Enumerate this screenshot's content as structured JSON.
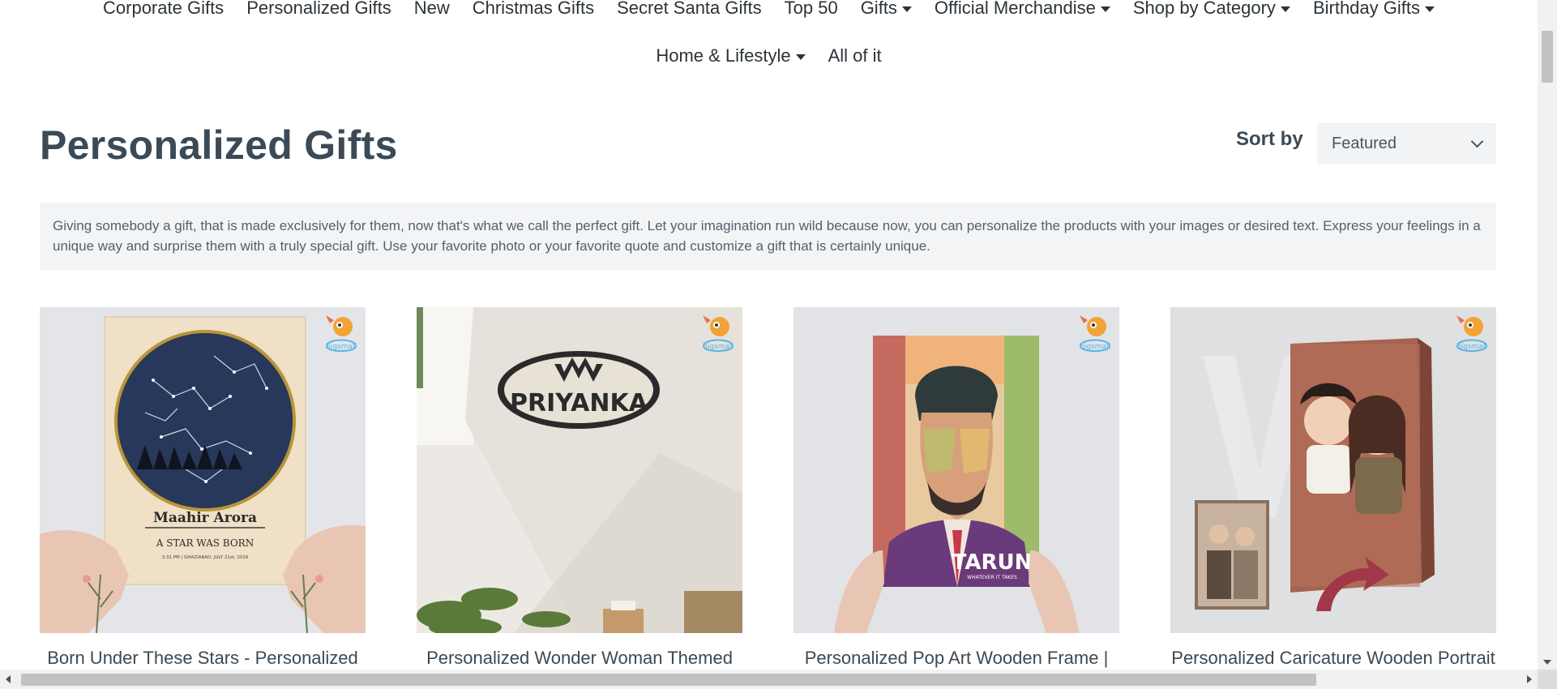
{
  "nav": {
    "row1": [
      {
        "label": "Corporate Gifts",
        "dropdown": false
      },
      {
        "label": "Personalized Gifts",
        "dropdown": false
      },
      {
        "label": "New",
        "dropdown": false
      },
      {
        "label": "Christmas Gifts",
        "dropdown": false
      },
      {
        "label": "Secret Santa Gifts",
        "dropdown": false
      },
      {
        "label": "Top 50",
        "dropdown": false
      },
      {
        "label": "Gifts",
        "dropdown": true
      },
      {
        "label": "Official Merchandise",
        "dropdown": true
      },
      {
        "label": "Shop by Category",
        "dropdown": true
      },
      {
        "label": "Birthday Gifts",
        "dropdown": true
      }
    ],
    "row2": [
      {
        "label": "Home & Lifestyle",
        "dropdown": true
      },
      {
        "label": "All of it",
        "dropdown": false
      }
    ]
  },
  "page": {
    "title": "Personalized Gifts",
    "sort_label": "Sort by",
    "sort_value": "Featured",
    "description": "Giving somebody a gift, that is made exclusively for them, now that's what we call the perfect gift. Let your imagination run wild because now, you can personalize the products with your images or desired text. Express your feelings in a unique way and surprise them with a truly special gift. Use your favorite photo or your favorite quote and customize a gift that is certainly unique."
  },
  "products": [
    {
      "name": "Born Under These Stars - Personalized",
      "image_texts": {
        "person": "Maahir Arora",
        "tagline": "A STAR WAS BORN",
        "details": "3:31 PM | GHAZIABAD, JULY 21st, 2016"
      }
    },
    {
      "name": "Personalized Wonder Woman Themed",
      "image_texts": {
        "person": "PRIYANKA"
      }
    },
    {
      "name": "Personalized Pop Art Wooden Frame |",
      "image_texts": {
        "person": "TARUN",
        "tagline": "WHATEVER IT TAKES"
      }
    },
    {
      "name": "Personalized Caricature Wooden Portrait",
      "image_texts": {}
    }
  ],
  "brand_badge": "bigsmall",
  "colors": {
    "text": "#3b4a56",
    "nav": "#2c3338",
    "panel": "#f2f4f6"
  }
}
